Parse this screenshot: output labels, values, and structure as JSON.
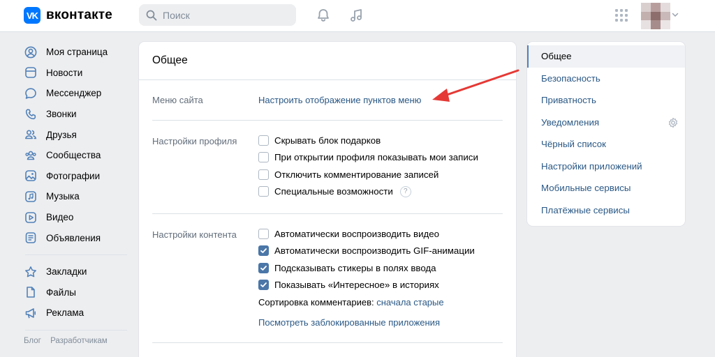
{
  "header": {
    "logo_mark": "VK",
    "logo_text": "вконтакте",
    "search_placeholder": "Поиск",
    "icons": [
      "bell-icon",
      "music-icon",
      "apps-grid-icon",
      "avatar",
      "chevron-down-icon"
    ]
  },
  "sidebar": {
    "items": [
      {
        "label": "Моя страница",
        "icon": "user-circle-icon"
      },
      {
        "label": "Новости",
        "icon": "news-icon"
      },
      {
        "label": "Мессенджер",
        "icon": "message-icon"
      },
      {
        "label": "Звонки",
        "icon": "phone-icon"
      },
      {
        "label": "Друзья",
        "icon": "friends-icon"
      },
      {
        "label": "Сообщества",
        "icon": "communities-icon"
      },
      {
        "label": "Фотографии",
        "icon": "photo-icon"
      },
      {
        "label": "Музыка",
        "icon": "music-icon"
      },
      {
        "label": "Видео",
        "icon": "video-icon"
      },
      {
        "label": "Объявления",
        "icon": "ads-icon"
      }
    ],
    "items2": [
      {
        "label": "Закладки",
        "icon": "star-icon"
      },
      {
        "label": "Файлы",
        "icon": "file-icon"
      },
      {
        "label": "Реклама",
        "icon": "megaphone-icon"
      }
    ],
    "footer": [
      "Блог",
      "Разработчикам"
    ]
  },
  "main": {
    "title": "Общее",
    "site_menu": {
      "label": "Меню сайта",
      "link": "Настроить отображение пунктов меню"
    },
    "profile": {
      "label": "Настройки профиля",
      "options": [
        {
          "label": "Скрывать блок подарков",
          "checked": false
        },
        {
          "label": "При открытии профиля показывать мои записи",
          "checked": false
        },
        {
          "label": "Отключить комментирование записей",
          "checked": false
        },
        {
          "label": "Специальные возможности",
          "checked": false,
          "help": "?"
        }
      ]
    },
    "content": {
      "label": "Настройки контента",
      "options": [
        {
          "label": "Автоматически воспроизводить видео",
          "checked": false
        },
        {
          "label": "Автоматически воспроизводить GIF-анимации",
          "checked": true
        },
        {
          "label": "Подсказывать стикеры в полях ввода",
          "checked": true
        },
        {
          "label": "Показывать «Интересное» в историях",
          "checked": true
        }
      ],
      "sort_label": "Сортировка комментариев:",
      "sort_value": "сначала старые",
      "blocked_apps_link": "Посмотреть заблокированные приложения"
    }
  },
  "right_menu": {
    "items": [
      {
        "label": "Общее",
        "active": true
      },
      {
        "label": "Безопасность"
      },
      {
        "label": "Приватность"
      },
      {
        "label": "Уведомления",
        "icon": "gear-icon"
      },
      {
        "label": "Чёрный список"
      },
      {
        "label": "Настройки приложений"
      },
      {
        "label": "Мобильные сервисы"
      },
      {
        "label": "Платёжные сервисы"
      }
    ]
  },
  "colors": {
    "accent": "#0077ff",
    "link": "#2a5885",
    "checkbox_checked": "#4a76a8",
    "annotation_arrow": "#e53935"
  }
}
